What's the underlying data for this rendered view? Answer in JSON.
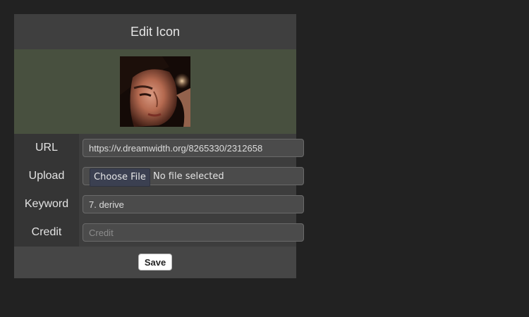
{
  "dialog": {
    "title": "Edit Icon",
    "preview": {
      "icon_name": "user-icon-photo",
      "background_color": "#48503f"
    },
    "fields": {
      "url": {
        "label": "URL",
        "value": "https://v.dreamwidth.org/8265330/2312658"
      },
      "upload": {
        "label": "Upload",
        "button_label": "Choose File",
        "status": "No file selected"
      },
      "keyword": {
        "label": "Keyword",
        "value": "7. derive"
      },
      "credit": {
        "label": "Credit",
        "value": "",
        "placeholder": "Credit"
      }
    },
    "save_label": "Save"
  },
  "colors": {
    "page_background": "#222222",
    "dialog_background": "#464646",
    "label_background": "#353535",
    "input_background": "#4b4b4b",
    "file_button_background": "#3b4051"
  }
}
